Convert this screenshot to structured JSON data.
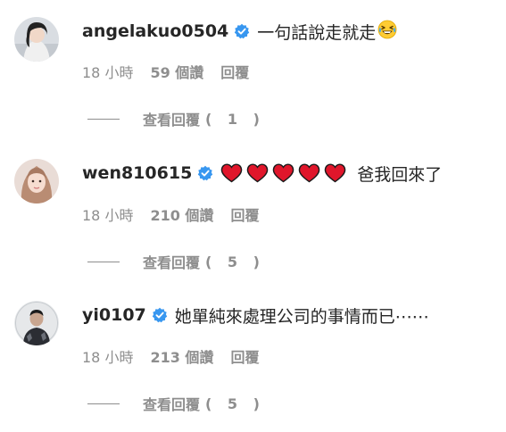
{
  "comments": [
    {
      "username": "angelakuo0504",
      "avatar": "profile-photo",
      "verified": true,
      "text": "一句話說走就走",
      "emoji": "grinning-squinting-face-with-tears-emoji",
      "time": "18 小時",
      "likes": "59 個讚",
      "reply": "回覆",
      "view_replies": "查看回覆",
      "reply_count": "( 1 )"
    },
    {
      "username": "wen810615",
      "avatar": "profile-photo",
      "verified": true,
      "hearts": [
        "red-heart-emoji",
        "red-heart-emoji",
        "red-heart-emoji",
        "red-heart-emoji",
        "red-heart-emoji"
      ],
      "text": "爸我回來了",
      "time": "18 小時",
      "likes": "210 個讚",
      "reply": "回覆",
      "view_replies": "查看回覆",
      "reply_count": "( 5 )"
    },
    {
      "username": "yi0107",
      "avatar": "profile-photo",
      "verified": true,
      "text": "她單純來處理公司的事情而已⋯⋯",
      "time": "18 小時",
      "likes": "213 個讚",
      "reply": "回覆",
      "view_replies": "查看回覆",
      "reply_count": "( 5 )"
    }
  ],
  "colors": {
    "primary_text": "#262626",
    "secondary_text": "#8e8e8e",
    "verified_badge": "#3897f0",
    "heart": "#e0162b"
  }
}
